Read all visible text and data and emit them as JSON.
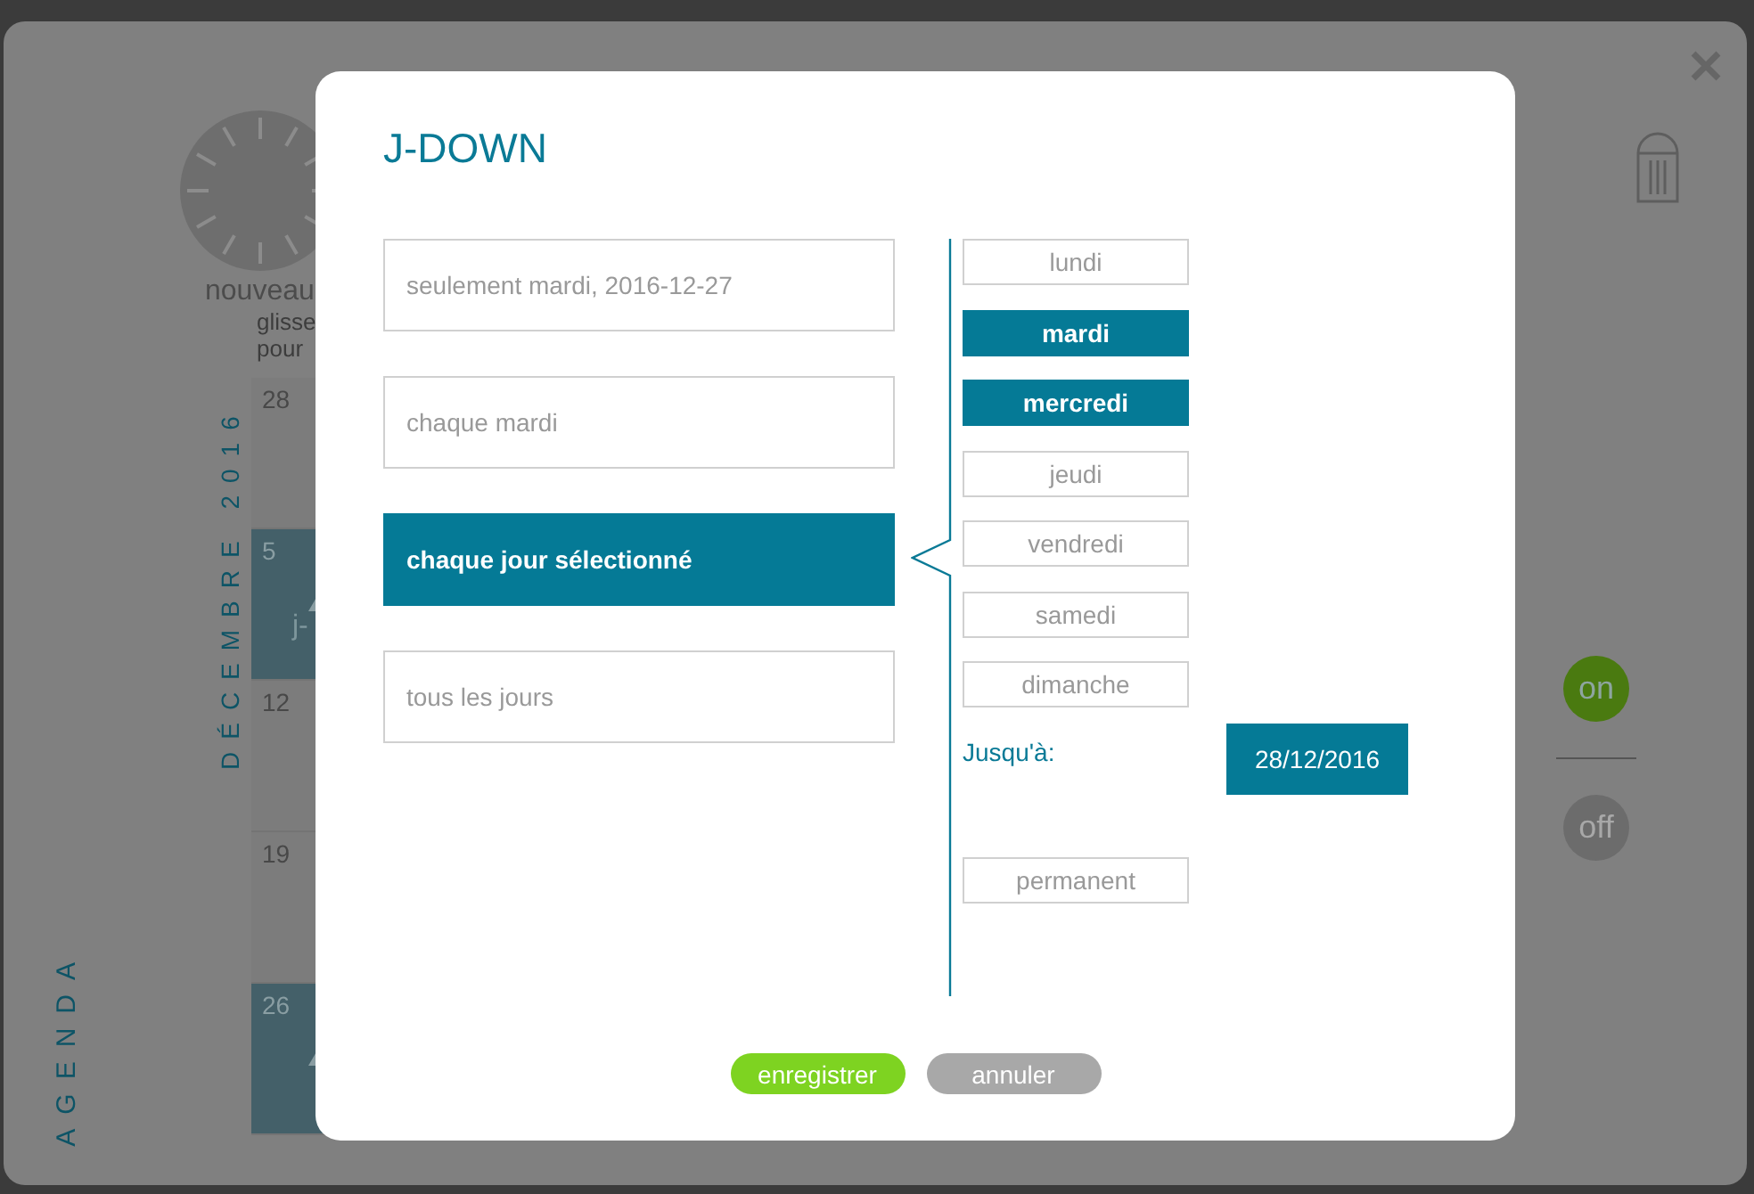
{
  "background": {
    "new_label": "nouveau",
    "hint_lines": [
      "glisse",
      "pour"
    ],
    "month_label": "DÉCEMBRE 2016",
    "section_label": "AGENDA",
    "calendar_cells": [
      {
        "day": "28",
        "highlighted": false
      },
      {
        "day": "5",
        "highlighted": true,
        "event": "j-"
      },
      {
        "day": "12",
        "highlighted": false
      },
      {
        "day": "19",
        "highlighted": false
      },
      {
        "day": "26",
        "highlighted": true
      }
    ],
    "toggles": [
      {
        "label": "on",
        "selected": true
      },
      {
        "label": "off",
        "selected": false
      }
    ]
  },
  "dialog": {
    "title": "J-DOWN",
    "repeat_options": [
      {
        "label": "seulement mardi, 2016-12-27",
        "selected": false
      },
      {
        "label": "chaque mardi",
        "selected": false
      },
      {
        "label": "chaque jour sélectionné",
        "selected": true
      },
      {
        "label": "tous les jours",
        "selected": false
      }
    ],
    "weekdays": [
      {
        "label": "lundi",
        "selected": false
      },
      {
        "label": "mardi",
        "selected": true
      },
      {
        "label": "mercredi",
        "selected": true
      },
      {
        "label": "jeudi",
        "selected": false
      },
      {
        "label": "vendredi",
        "selected": false
      },
      {
        "label": "samedi",
        "selected": false
      },
      {
        "label": "dimanche",
        "selected": false
      }
    ],
    "until_label": "Jusqu'à:",
    "until_date": "28/12/2016",
    "permanent": {
      "label": "permanent",
      "selected": false
    },
    "buttons": [
      {
        "label": "enregistrer",
        "kind": "primary"
      },
      {
        "label": "annuler",
        "kind": "secondary"
      }
    ]
  }
}
